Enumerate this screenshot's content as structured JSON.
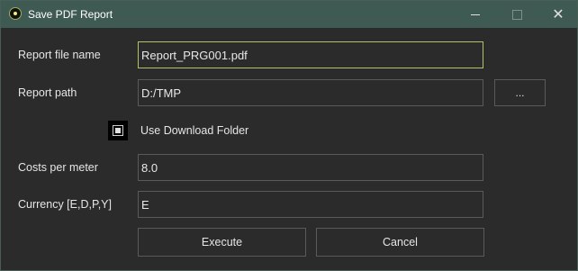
{
  "window": {
    "title": "Save PDF Report",
    "minimize_icon": "minimize-icon",
    "maximize_icon": "maximize-icon",
    "close_icon": "close-icon",
    "close_glyph": "✕"
  },
  "form": {
    "file_name_label": "Report file name",
    "file_name_value": "Report_PRG001.pdf",
    "path_label": "Report path",
    "path_value": "D:/TMP",
    "browse_label": "...",
    "use_download_label": "Use Download Folder",
    "use_download_checked": true,
    "costs_label": "Costs per meter",
    "costs_value": "8.0",
    "currency_label": "Currency [E,D,P,Y]",
    "currency_value": "E"
  },
  "actions": {
    "execute_label": "Execute",
    "cancel_label": "Cancel"
  },
  "colors": {
    "titlebar": "#3e5a52",
    "background": "#2b2b2b",
    "focus_border": "#b5c06a"
  }
}
